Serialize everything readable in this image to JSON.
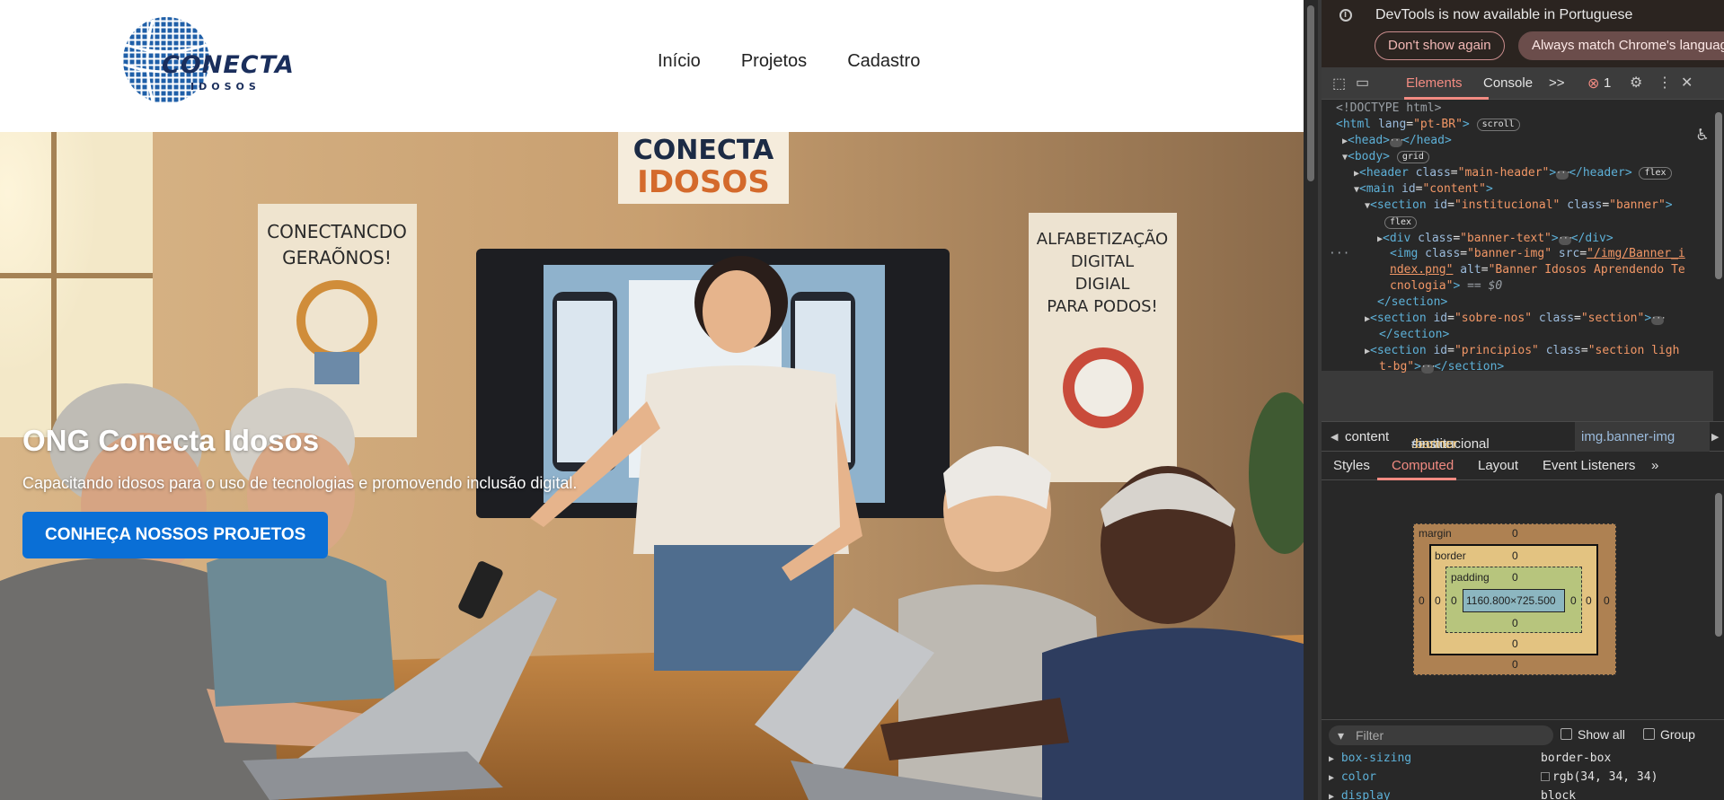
{
  "site": {
    "logo": {
      "name": "CONECTA",
      "sub": "IDOSOS"
    },
    "nav": [
      "Início",
      "Projetos",
      "Cadastro"
    ],
    "banner": {
      "title": "ONG Conecta Idosos",
      "subtitle": "Capacitando idosos para o uso de tecnologias e promovendo inclusão digital.",
      "button": "CONHEÇA NOSSOS PROJETOS",
      "photo_signs": {
        "top": [
          "CONECTA",
          "IDOSOS"
        ],
        "left": [
          "CONECTANCDO",
          "GERAÕNOS!"
        ],
        "right": [
          "ALFABETIZAÇÃO",
          "DIGITAL",
          "DIGIAL",
          "PARA PODOS!"
        ]
      }
    },
    "accent_color": "#0a6fd6"
  },
  "devtools": {
    "notice": {
      "text": "DevTools is now available in Portuguese",
      "dont_show": "Don't show again",
      "always_match": "Always match Chrome's language"
    },
    "tabs": {
      "elements": "Elements",
      "console": "Console",
      "more": ">>",
      "error_count": "1"
    },
    "dom": {
      "doctype": "<!DOCTYPE html>",
      "html_open": "<html",
      "html_lang_attr": "lang",
      "html_lang_val": "\"pt-BR\"",
      "scroll_badge": "scroll",
      "head": "<head>",
      "head_close": "</head>",
      "body": "<body>",
      "grid_badge": "grid",
      "header_open": "<header",
      "header_class_attr": "class",
      "header_class_val": "\"main-header\"",
      "header_close": "</header>",
      "flex_badge": "flex",
      "main_open": "<main",
      "main_id_attr": "id",
      "main_id_val": "\"content\"",
      "section1_open": "<section",
      "section1_id": "\"institucional\"",
      "section1_class": "\"banner\"",
      "div_open": "<div",
      "div_class": "\"banner-text\"",
      "div_close": "</div>",
      "img_open": "<img",
      "img_class": "\"banner-img\"",
      "img_src_a": "\"/img/Banner_i",
      "img_src_b": "ndex.png\"",
      "img_alt_a": "\"Banner Idosos Aprendendo Te",
      "img_alt_b": "cnologia\"",
      "img_dollar": "== $0",
      "section_close": "</section>",
      "section2_id": "\"sobre-nos\"",
      "section2_class": "\"section\"",
      "section3_id": "\"principios\"",
      "section3_class_a": "\"section ligh",
      "section3_class_b": "t-bg\"",
      "attr_id": "id",
      "attr_class": "class",
      "attr_src": "src",
      "attr_alt": "alt",
      "gt": ">"
    },
    "breadcrumbs": {
      "content": "content",
      "section_tag": "section",
      "section_id": "#institucional",
      "section_class": ".banner",
      "img": "img.banner-img"
    },
    "subtabs": [
      "Styles",
      "Computed",
      "Layout",
      "Event Listeners"
    ],
    "box_model": {
      "margin_label": "margin",
      "border_label": "border",
      "padding_label": "padding",
      "content": "1160.800×725.500",
      "zero": "0"
    },
    "filter": {
      "placeholder": "Filter",
      "show_all": "Show all",
      "group": "Group"
    },
    "computed": [
      {
        "name": "box-sizing",
        "value": "border-box"
      },
      {
        "name": "color",
        "value": "rgb(34, 34, 34)"
      },
      {
        "name": "display",
        "value": "block"
      }
    ]
  }
}
